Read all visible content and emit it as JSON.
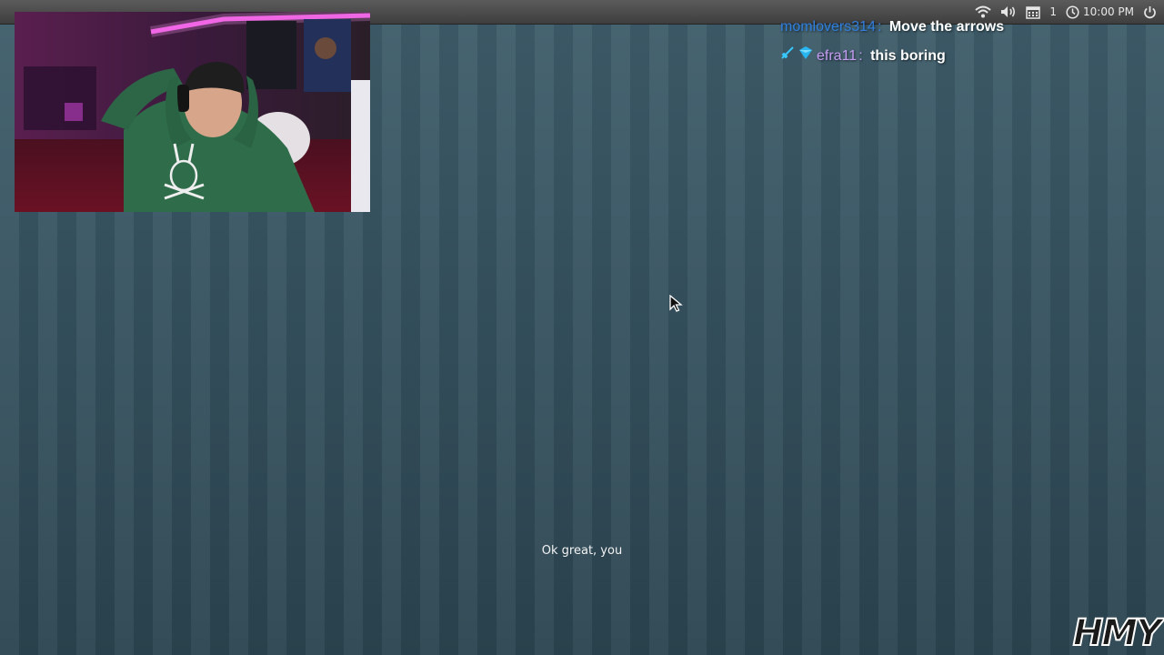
{
  "system_tray": {
    "workspace_number": "1",
    "clock_time": "10:00 PM",
    "icons": [
      "wifi-icon",
      "volume-icon",
      "calendar-icon",
      "clock-icon",
      "power-icon"
    ]
  },
  "chat": {
    "messages": [
      {
        "user": "momlovers314",
        "separator": ":",
        "text": "Move the arrows",
        "user_color": "#2f7fe0"
      },
      {
        "user": "efra11",
        "separator": ":",
        "text": "this boring",
        "user_color": "#c79cf5",
        "badges": [
          "sword-badge-icon",
          "diamond-badge-icon"
        ]
      }
    ]
  },
  "subtitle": "Ok great, you",
  "watermark": "HMY",
  "colors": {
    "desktop_background": "#3e5a67",
    "top_bar": "#4a4a4a"
  }
}
